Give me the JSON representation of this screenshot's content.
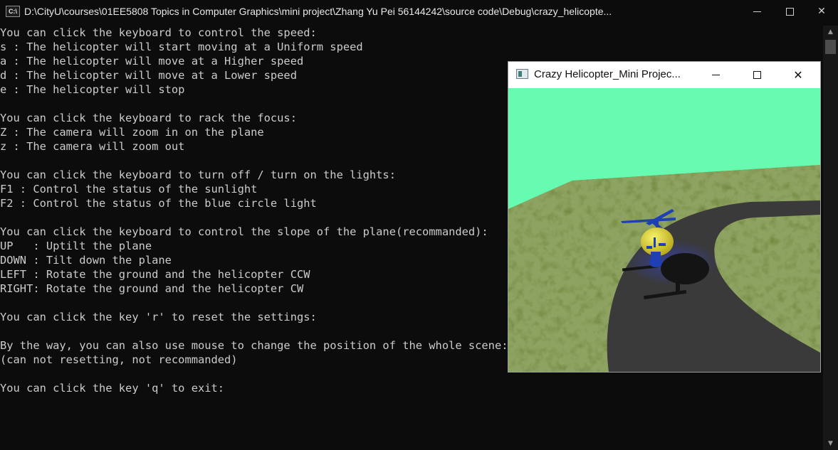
{
  "console": {
    "title": "D:\\CityU\\courses\\01EE5808 Topics in Computer Graphics\\mini project\\Zhang Yu Pei 56144242\\source code\\Debug\\crazy_helicopte...",
    "icon_text": "C:\\",
    "lines": [
      "You can click the keyboard to control the speed:",
      "s : The helicopter will start moving at a Uniform speed",
      "a : The helicopter will move at a Higher speed",
      "d : The helicopter will move at a Lower speed",
      "e : The helicopter will stop",
      "",
      "You can click the keyboard to rack the focus:",
      "Z : The camera will zoom in on the plane",
      "z : The camera will zoom out",
      "",
      "You can click the keyboard to turn off / turn on the lights:",
      "F1 : Control the status of the sunlight",
      "F2 : Control the status of the blue circle light",
      "",
      "You can click the keyboard to control the slope of the plane(recommanded):",
      "UP   : Uptilt the plane",
      "DOWN : Tilt down the plane",
      "LEFT : Rotate the ground and the helicopter CCW",
      "RIGHT: Rotate the ground and the helicopter CW",
      "",
      "You can click the key 'r' to reset the settings:",
      "",
      "By the way, you can also use mouse to change the position of the whole scene:",
      "(can not resetting, not recommanded)",
      "",
      "You can click the key 'q' to exit:"
    ],
    "close_glyph": "✕",
    "scroll_up_glyph": "▲",
    "scroll_down_glyph": "▼"
  },
  "gl_window": {
    "title": "Crazy Helicopter_Mini Projec...",
    "close_glyph": "✕",
    "scene": {
      "sky_color": "#66fbb0",
      "grass_color": "#5f7a2a",
      "road_color": "#3a3a3a",
      "helicopter_body_color": "#e8e43a",
      "rotor_color": "#1f3fb5",
      "light_color": "#3340e0"
    }
  }
}
